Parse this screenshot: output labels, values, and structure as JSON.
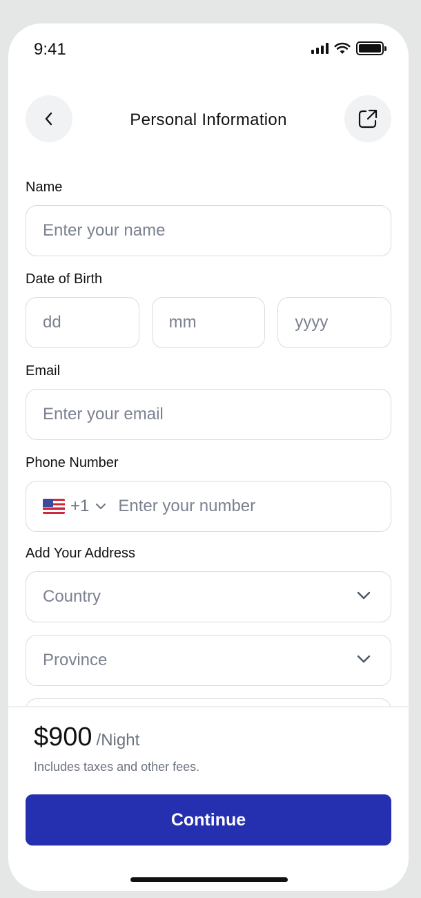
{
  "status_bar": {
    "time": "9:41"
  },
  "header": {
    "title": "Personal Information"
  },
  "form": {
    "name": {
      "label": "Name",
      "placeholder": "Enter your name"
    },
    "dob": {
      "label": "Date of Birth",
      "day": "dd",
      "month": "mm",
      "year": "yyyy"
    },
    "email": {
      "label": "Email",
      "placeholder": "Enter your email"
    },
    "phone": {
      "label": "Phone Number",
      "country_code": "+1",
      "placeholder": "Enter your number"
    },
    "address": {
      "label": "Add Your Address",
      "country": "Country",
      "province": "Province"
    }
  },
  "footer": {
    "price": "$900",
    "per": "/Night",
    "fees": "Includes taxes and other fees.",
    "continue_label": "Continue"
  },
  "colors": {
    "primary": "#2430b0",
    "border": "#d9dbe0",
    "placeholder": "#7b8190"
  }
}
